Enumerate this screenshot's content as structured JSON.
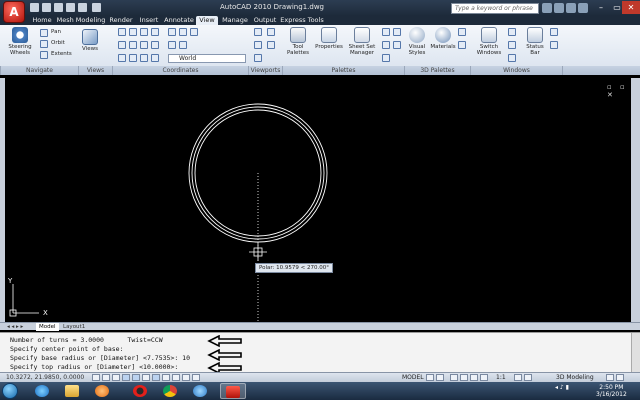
{
  "window": {
    "app_logo": "A",
    "title": "AutoCAD 2010    Drawing1.dwg",
    "search_placeholder": "Type a keyword or phrase",
    "minimize": "–",
    "maximize": "▭",
    "close": "✕"
  },
  "ribbon_tabs": [
    "Home",
    "Mesh Modeling",
    "Render",
    "Insert",
    "Annotate",
    "View",
    "Manage",
    "Output",
    "Express Tools"
  ],
  "active_tab": "View",
  "ribbon": {
    "navigate": {
      "title": "Navigate",
      "steering_wheels": "Steering Wheels",
      "pan": "Pan",
      "orbit": "Orbit",
      "extents": "Extents"
    },
    "views": {
      "title": "Views",
      "views_button": "Views"
    },
    "coordinates": {
      "title": "Coordinates",
      "ucs_value": "World"
    },
    "viewports": {
      "title": "Viewports"
    },
    "palettes": {
      "title": "Palettes",
      "tool_palettes": "Tool Palettes",
      "properties": "Properties",
      "sheet_set_manager": "Sheet Set Manager"
    },
    "palettes_3d": {
      "title": "3D Palettes",
      "visual_styles": "Visual Styles",
      "materials": "Materials"
    },
    "windows": {
      "title": "Windows",
      "switch_windows": "Switch Windows",
      "status_bar": "Status Bar"
    }
  },
  "drawing": {
    "tooltip": "Polar: 10.9579 < 270.00°",
    "ucs_y": "Y",
    "ucs_x": "X",
    "window_controls": "▫ ▫ ✕"
  },
  "layout_tabs": {
    "model": "Model",
    "layout1": "Layout1",
    "nav": "◂ ◂ ▸ ▸"
  },
  "command_lines": [
    "Number of turns = 3.0000      Twist=CCW",
    "Specify center point of base:",
    "Specify base radius or [Diameter] <7.7535>: 10",
    "Specify top radius or [Diameter] <10.0000>:"
  ],
  "status": {
    "coordinates": "10.3272, 21.9850, 0.0000",
    "model": "MODEL",
    "scale": "1:1",
    "workspace": "3D Modeling"
  },
  "taskbar": {
    "tray": "◂ ♪ ▮",
    "time": "2:50 PM",
    "date": "3/16/2012"
  }
}
